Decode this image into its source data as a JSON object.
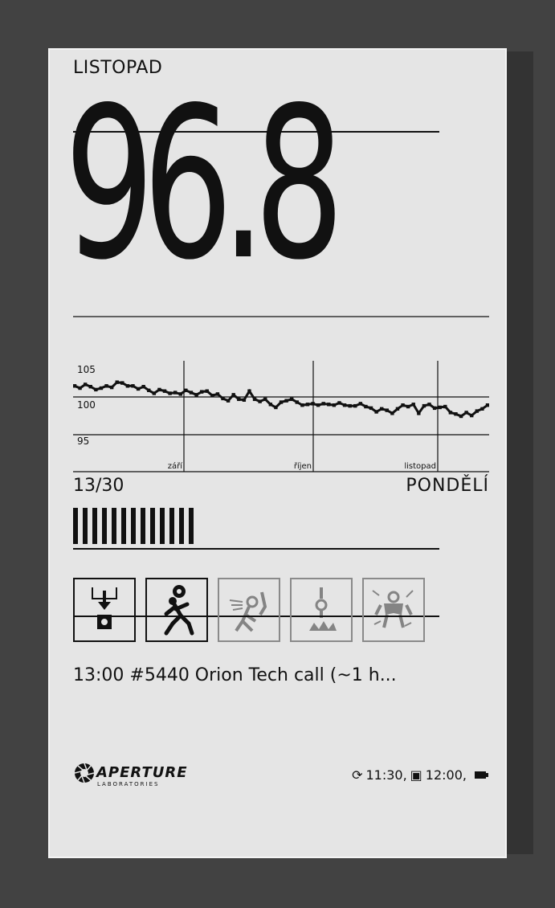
{
  "header": {
    "title": "LISTOPAD"
  },
  "main": {
    "value": "96.8"
  },
  "chart_data": {
    "type": "line",
    "y_ticks": [
      "105",
      "100",
      "95"
    ],
    "ylim": [
      94,
      106
    ],
    "month_labels": [
      "září",
      "říjen",
      "listopad"
    ],
    "series": [
      {
        "values": [
          101.6,
          101.3,
          101.8,
          101.5,
          101.1,
          101.3,
          101.6,
          101.4,
          102.1,
          102.0,
          101.6,
          101.6,
          101.2,
          101.5,
          101.0,
          100.6,
          101.1,
          100.9,
          100.6,
          100.7,
          100.5,
          101.0,
          100.7,
          100.4,
          100.8,
          100.9,
          100.3,
          100.5,
          99.9,
          99.6,
          100.4,
          99.8,
          99.7,
          100.9,
          99.8,
          99.5,
          99.8,
          99.1,
          98.7,
          99.4,
          99.6,
          99.8,
          99.4,
          99.0,
          99.1,
          99.2,
          99.0,
          99.2,
          99.1,
          99.0,
          99.3,
          99.0,
          98.9,
          98.9,
          99.2,
          98.8,
          98.6,
          98.1,
          98.5,
          98.3,
          97.9,
          98.5,
          99.0,
          98.8,
          99.1,
          97.9,
          98.9,
          99.1,
          98.6,
          98.7,
          98.8,
          98.0,
          97.8,
          97.5,
          98.0,
          97.6,
          98.2,
          98.5,
          99.0
        ]
      }
    ]
  },
  "calendar": {
    "day_count": "13/30",
    "weekday": "PONDĚLÍ",
    "progress_days": 13,
    "days_in_month": 30
  },
  "activity_icons": [
    {
      "name": "cube-drop-icon",
      "active": true
    },
    {
      "name": "running-person-icon",
      "active": true
    },
    {
      "name": "person-hit-icon",
      "active": false
    },
    {
      "name": "falling-object-icon",
      "active": false
    },
    {
      "name": "electrocuted-person-icon",
      "active": false
    }
  ],
  "event": {
    "text": "13:00 #5440 Orion Tech call (~1 h..."
  },
  "footer": {
    "logo_text": "APERTURE",
    "logo_subtext": "LABORATORIES",
    "sync_icon": "refresh-icon",
    "sync_time": "11:30,",
    "calendar_icon": "calendar-icon",
    "calendar_time": "12:00,",
    "battery_icon": "battery-icon"
  }
}
